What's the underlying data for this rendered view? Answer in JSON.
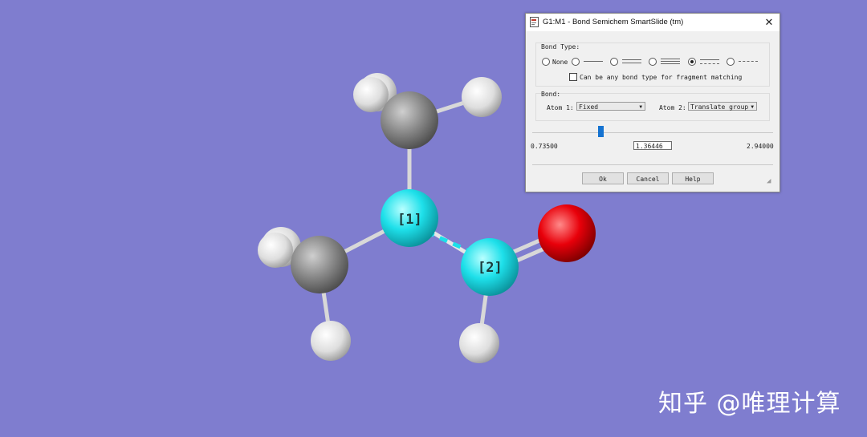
{
  "molecule": {
    "atom1_label": "[1]",
    "atom2_label": "[2]",
    "colors": {
      "background": "#7f7dcf",
      "carbon": "#8a8a8a",
      "nitrogen": "#1ce0ea",
      "oxygen": "#e8000a",
      "hydrogen": "#efefef",
      "bond": "#dcdcdc",
      "highlight_bond": "#1ce0ea"
    }
  },
  "dialog": {
    "title": "G1:M1 - Bond Semichem SmartSlide (tm)",
    "close_icon": "close-icon",
    "bond_type": {
      "group_label": "Bond Type:",
      "options": [
        {
          "label": "None",
          "selected": false
        },
        {
          "label": "",
          "style": "single",
          "selected": false
        },
        {
          "label": "",
          "style": "double",
          "selected": false
        },
        {
          "label": "",
          "style": "triple",
          "selected": false
        },
        {
          "label": "",
          "style": "aromatic",
          "selected": true
        },
        {
          "label": "",
          "style": "dashed",
          "selected": false
        }
      ],
      "any_type_label": "Can be any bond type for fragment matching",
      "any_type_checked": false
    },
    "bond": {
      "group_label": "Bond:",
      "atom1_label": "Atom 1:",
      "atom1_value": "Fixed",
      "atom2_label": "Atom 2:",
      "atom2_value": "Translate group"
    },
    "slider": {
      "min": "0.73500",
      "max": "2.94000",
      "value": "1.36446",
      "fraction": 0.286
    },
    "buttons": {
      "ok": "Ok",
      "cancel": "Cancel",
      "help": "Help"
    }
  },
  "watermark": "知乎 @唯理计算"
}
